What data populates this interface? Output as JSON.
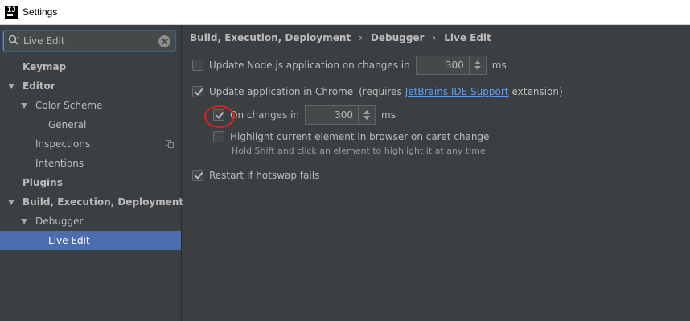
{
  "window": {
    "title": "Settings"
  },
  "search": {
    "value": "Live Edit",
    "placeholder": ""
  },
  "sidebar": {
    "items": [
      {
        "label": "Keymap"
      },
      {
        "label": "Editor"
      },
      {
        "label": "Color Scheme"
      },
      {
        "label": "General"
      },
      {
        "label": "Inspections"
      },
      {
        "label": "Intentions"
      },
      {
        "label": "Plugins"
      },
      {
        "label": "Build, Execution, Deployment"
      },
      {
        "label": "Debugger"
      },
      {
        "label": "Live Edit"
      }
    ]
  },
  "breadcrumb": {
    "items": [
      "Build, Execution, Deployment",
      "Debugger",
      "Live Edit"
    ],
    "separator": "›"
  },
  "settings": {
    "node_update": {
      "label": "Update Node.js application on changes in",
      "value": "300",
      "unit": "ms",
      "checked": false
    },
    "chrome_update": {
      "label": "Update application in Chrome",
      "prefix": "(requires",
      "link": "JetBrains IDE Support",
      "suffix": "extension)",
      "checked": true
    },
    "on_changes": {
      "label": "On changes in",
      "value": "300",
      "unit": "ms",
      "checked": true
    },
    "highlight": {
      "label": "Highlight current element in browser on caret change",
      "hint": "Hold Shift and click an element to highlight it at any time",
      "checked": false
    },
    "restart": {
      "label": "Restart if hotswap fails",
      "checked": true
    }
  },
  "colors": {
    "selection": "#4b6eaf",
    "link": "#589df6",
    "annotation": "#e02020"
  }
}
